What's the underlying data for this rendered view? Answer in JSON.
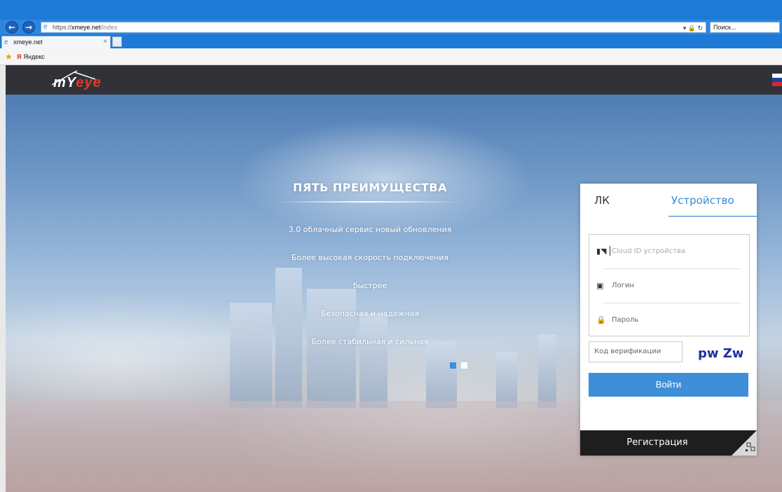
{
  "browser": {
    "url_scheme": "https://",
    "url_host": "xmeye.net",
    "url_path": "/index",
    "search_placeholder": "Поиск...",
    "tab_title": "xmeye.net",
    "tab_close": "×",
    "favorites_item": "Яндекс",
    "back_glyph": "←",
    "forward_glyph": "→"
  },
  "site": {
    "logo_prefix": "mY",
    "logo_suffix": "eye",
    "flag_colors": [
      "#ffffff",
      "#1c3fa8",
      "#d42a2a"
    ]
  },
  "hero": {
    "title": "ПЯТЬ ПРЕИМУЩЕСТВА",
    "features": [
      "3.0 облачный сервис новый обновления",
      "Более высокая скорость подключения",
      "быстрее",
      "Безопасная и надежная",
      "Более стабильная и сильная"
    ],
    "slides": 2,
    "active_slide": 0
  },
  "login": {
    "tab_account": "ЛК",
    "tab_device": "Устройство",
    "cloud_id_placeholder": "Cloud ID устройства",
    "login_label": "Логин",
    "password_label": "Пароль",
    "verification_placeholder": "Код верификации",
    "captcha_text": "pw Zw",
    "submit": "Войти",
    "register": "Регистрация"
  },
  "colors": {
    "accent": "#3f8fd8",
    "header_bg": "#303238",
    "register_bg": "#1e1e1e"
  }
}
